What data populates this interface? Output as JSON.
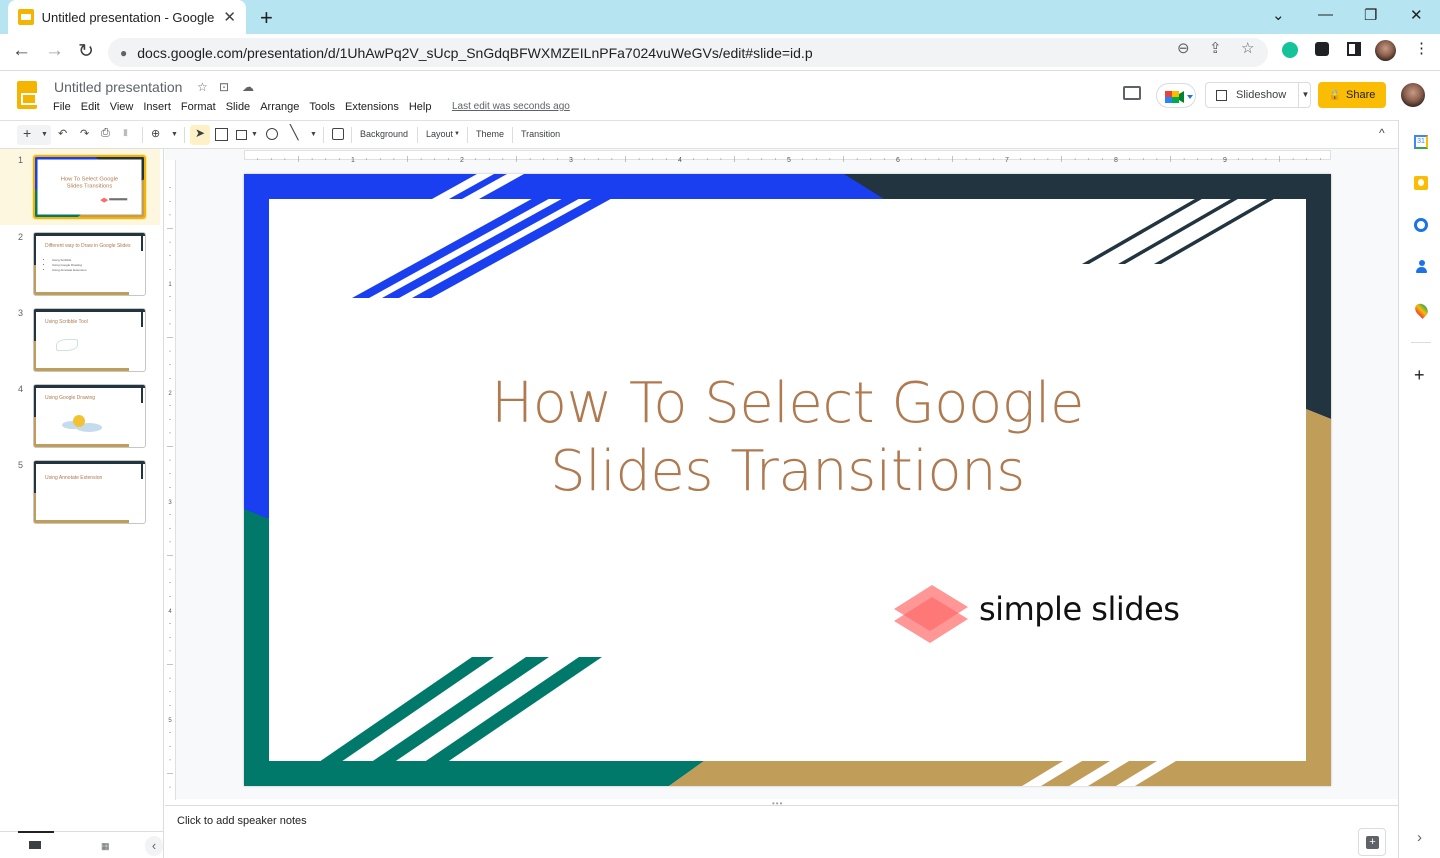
{
  "browser": {
    "tab_title": "Untitled presentation - Google Sl",
    "url": "docs.google.com/presentation/d/1UhAwPq2V_sUcp_SnGdqBFWXMZEILnPFa7024vuWeGVs/edit#slide=id.p",
    "new_tab": "+",
    "close_tab": "✕",
    "win_tabsearch": "⌄",
    "win_minimize": "—",
    "win_restore": "❐",
    "win_close": "✕",
    "back": "←",
    "forward": "→",
    "reload": "↻",
    "lock": "🔒",
    "zoom_icon": "⊖",
    "share_icon": "⇪",
    "star_icon": "☆",
    "menu_icon": "⋮"
  },
  "docs": {
    "title": "Untitled presentation",
    "star": "☆",
    "move": "⊡",
    "cloud": "☁",
    "menus": [
      "File",
      "Edit",
      "View",
      "Insert",
      "Format",
      "Slide",
      "Arrange",
      "Tools",
      "Extensions",
      "Help"
    ],
    "last_edit": "Last edit was seconds ago",
    "slideshow_label": "Slideshow",
    "share_label": "Share",
    "colors": {
      "accent": "#f4b400",
      "share": "#fbbc04"
    }
  },
  "toolbar": {
    "new_slide": "+",
    "undo": "↶",
    "redo": "↷",
    "print": "⎙",
    "paint": "🖌",
    "zoom": "⊕",
    "background": "Background",
    "layout": "Layout",
    "theme": "Theme",
    "transition": "Transition",
    "collapse": "^"
  },
  "ruler": {
    "h_labels": [
      "1",
      "2",
      "3",
      "4",
      "5",
      "6",
      "7",
      "8",
      "9"
    ],
    "v_labels": [
      "1",
      "2",
      "3",
      "4",
      "5"
    ]
  },
  "slides": [
    {
      "num": "1",
      "title": "How To Select Google Slides Transitions",
      "selected": true
    },
    {
      "num": "2",
      "title": "Different way to Draw in Google Slides",
      "bullets": [
        "Using Scribble",
        "Using Google Drawing",
        "Using Annotate Extension"
      ]
    },
    {
      "num": "3",
      "title": "Using Scribble Tool"
    },
    {
      "num": "4",
      "title": "Using Google Drawing"
    },
    {
      "num": "5",
      "title": "Using Annotate Extension"
    }
  ],
  "main_slide": {
    "title_line1": "How To Select Google",
    "title_line2": "Slides Transitions",
    "logo_text": "simple slides",
    "colors": {
      "title": "#b07a50",
      "blue": "#1a3ff0",
      "dark": "#21343f",
      "green": "#00796b",
      "gold": "#c19d5a",
      "logo": "#ff6b6b"
    }
  },
  "notes": {
    "placeholder": "Click to add speaker notes"
  },
  "side_panel": {
    "add": "+",
    "expand": "›"
  },
  "film_controls": {
    "collapse": "‹"
  }
}
